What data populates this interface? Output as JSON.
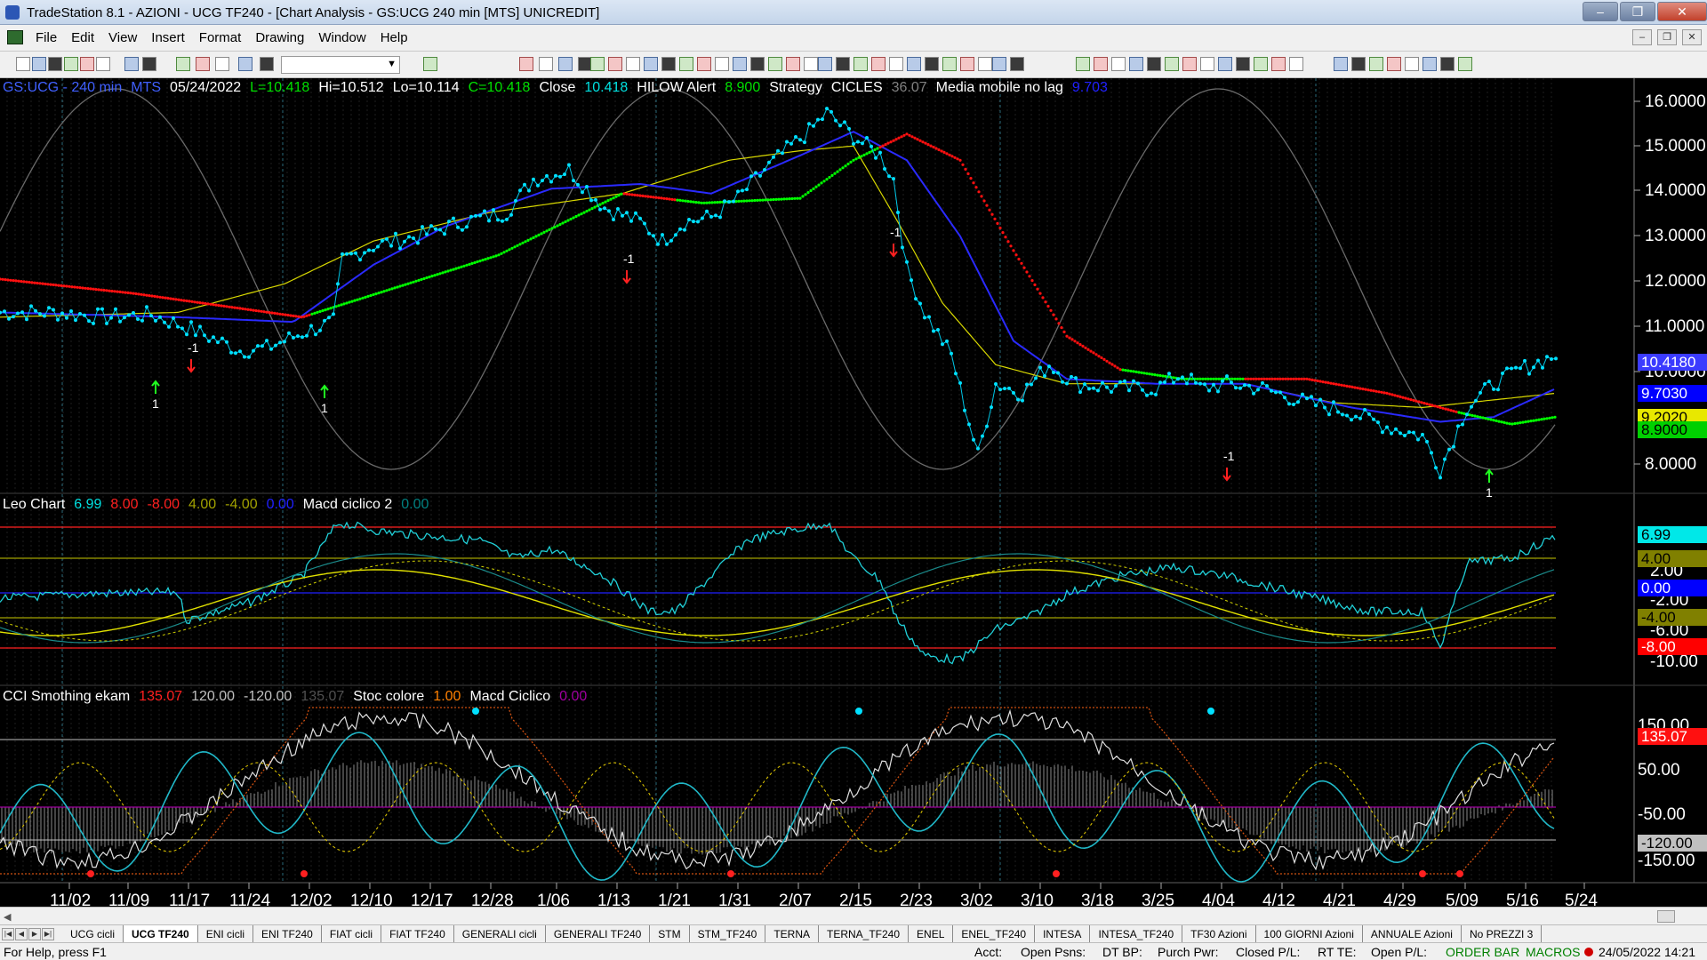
{
  "window": {
    "title": "TradeStation 8.1 - AZIONI - UCG TF240 - [Chart Analysis - GS:UCG  240 min  [MTS] UNICREDIT]",
    "minimize": "–",
    "maximize": "❐",
    "close": "✕"
  },
  "menu": {
    "items": [
      "File",
      "Edit",
      "View",
      "Insert",
      "Format",
      "Drawing",
      "Window",
      "Help"
    ],
    "mdi_min": "–",
    "mdi_restore": "❐",
    "mdi_close": "✕"
  },
  "price_pane": {
    "legend": [
      {
        "text": "GS:UCG - 240 min",
        "color": "#4060ff"
      },
      {
        "text": "MTS",
        "color": "#4060ff"
      },
      {
        "text": "05/24/2022",
        "color": "#ffffff"
      },
      {
        "text": "L=10.418",
        "color": "#00e000"
      },
      {
        "text": "Hi=10.512",
        "color": "#ffffff"
      },
      {
        "text": "Lo=10.114",
        "color": "#ffffff"
      },
      {
        "text": "C=10.418",
        "color": "#00e000"
      },
      {
        "text": "Close",
        "color": "#ffffff"
      },
      {
        "text": "10.418",
        "color": "#00e0e0"
      },
      {
        "text": "HILOW Alert",
        "color": "#ffffff"
      },
      {
        "text": "8.900",
        "color": "#00e000"
      },
      {
        "text": "Strategy",
        "color": "#ffffff"
      },
      {
        "text": "CICLES",
        "color": "#ffffff"
      },
      {
        "text": "36.07",
        "color": "#808080"
      },
      {
        "text": "Media mobile no lag",
        "color": "#ffffff"
      },
      {
        "text": "9.703",
        "color": "#2020ff"
      }
    ],
    "axis_labels": [
      "16.0000",
      "15.0000",
      "14.0000",
      "13.0000",
      "12.0000",
      "11.0000",
      "10.0000",
      "8.0000"
    ],
    "tags": [
      {
        "text": "10.4180",
        "bg": "#3b3bff",
        "fg": "#ffffff"
      },
      {
        "text": "9.7030",
        "bg": "#0000ff",
        "fg": "#ffffff"
      },
      {
        "text": "9.2020",
        "bg": "#e8e800",
        "fg": "#000000"
      },
      {
        "text": "8.9000",
        "bg": "#00d000",
        "fg": "#000000"
      }
    ],
    "signals": [
      {
        "text": "-1",
        "kind": "sell"
      },
      {
        "text": "1",
        "kind": "buy"
      },
      {
        "text": "1",
        "kind": "buy"
      },
      {
        "text": "-1",
        "kind": "sell"
      },
      {
        "text": "-1",
        "kind": "sell"
      },
      {
        "text": "-1",
        "kind": "sell"
      },
      {
        "text": "1",
        "kind": "buy"
      }
    ]
  },
  "leo_pane": {
    "legend": [
      {
        "text": "Leo Chart",
        "color": "#ffffff"
      },
      {
        "text": "6.99",
        "color": "#00e0e0"
      },
      {
        "text": "8.00",
        "color": "#ff2020"
      },
      {
        "text": "-8.00",
        "color": "#ff2020"
      },
      {
        "text": "4.00",
        "color": "#a0a000"
      },
      {
        "text": "-4.00",
        "color": "#a0a000"
      },
      {
        "text": "0.00",
        "color": "#2020ff"
      },
      {
        "text": "Macd ciclico 2",
        "color": "#ffffff"
      },
      {
        "text": "0.00",
        "color": "#008080"
      }
    ],
    "axis_labels": [
      "2.00",
      "-2.00",
      "-6.00",
      "-10.00"
    ],
    "tags": [
      {
        "text": "6.99",
        "bg": "#00e8e8",
        "fg": "#000000"
      },
      {
        "text": "4.00",
        "bg": "#808000",
        "fg": "#000000"
      },
      {
        "text": "0.00",
        "bg": "#0000ff",
        "fg": "#ffffff"
      },
      {
        "text": "-4.00",
        "bg": "#808000",
        "fg": "#000000"
      },
      {
        "text": "-8.00",
        "bg": "#ff0000",
        "fg": "#ffffff"
      }
    ]
  },
  "cci_pane": {
    "legend": [
      {
        "text": "CCI Smothing ekam",
        "color": "#ffffff"
      },
      {
        "text": "135.07",
        "color": "#ff2020"
      },
      {
        "text": "120.00",
        "color": "#c0c0c0"
      },
      {
        "text": "-120.00",
        "color": "#c0c0c0"
      },
      {
        "text": "135.07",
        "color": "#505050"
      },
      {
        "text": "Stoc colore",
        "color": "#ffffff"
      },
      {
        "text": "1.00",
        "color": "#ff8000"
      },
      {
        "text": "Macd Ciclico",
        "color": "#ffffff"
      },
      {
        "text": "0.00",
        "color": "#a000a0"
      }
    ],
    "axis_labels": [
      "150.00",
      "50.00",
      "-50.00",
      "-150.00"
    ],
    "tags": [
      {
        "text": "135.07",
        "bg": "#ff1010",
        "fg": "#ffffff"
      },
      {
        "text": "-120.00",
        "bg": "#c0c0c0",
        "fg": "#000000"
      }
    ]
  },
  "time_axis": [
    "11/02",
    "11/09",
    "11/17",
    "11/24",
    "12/02",
    "12/10",
    "12/17",
    "12/28",
    "1/06",
    "1/13",
    "1/21",
    "1/31",
    "2/07",
    "2/15",
    "2/23",
    "3/02",
    "3/10",
    "3/18",
    "3/25",
    "4/04",
    "4/12",
    "4/21",
    "4/29",
    "5/09",
    "5/16",
    "5/24"
  ],
  "tabs": [
    "UCG cicli",
    "UCG TF240",
    "ENI cicli",
    "ENI TF240",
    "FIAT cicli",
    "FIAT TF240",
    "GENERALI cicli",
    "GENERALI TF240",
    "STM",
    "STM_TF240",
    "TERNA",
    "TERNA_TF240",
    "ENEL",
    "ENEL_TF240",
    "INTESA",
    "INTESA_TF240",
    "TF30 Azioni",
    "100 GIORNI Azioni",
    "ANNUALE Azioni",
    "No PREZZI 3"
  ],
  "active_tab": "UCG TF240",
  "status": {
    "help": "For Help, press F1",
    "acct": "Acct:",
    "open_psns": "Open Psns:",
    "dt_bp": "DT BP:",
    "purch_pwr": "Purch Pwr:",
    "closed_pl": "Closed P/L:",
    "rt_te": "RT TE:",
    "open_pl": "Open P/L:",
    "order_bar": "ORDER BAR",
    "macros": "MACROS",
    "datetime": "24/05/2022 14:21"
  },
  "colors": {
    "price": "#00e0ff",
    "blue_ma": "#2a2aff",
    "yellow_ma": "#d8d800",
    "green_dots": "#00ff00",
    "red_dots": "#ff1010",
    "cycle": "#707070"
  }
}
